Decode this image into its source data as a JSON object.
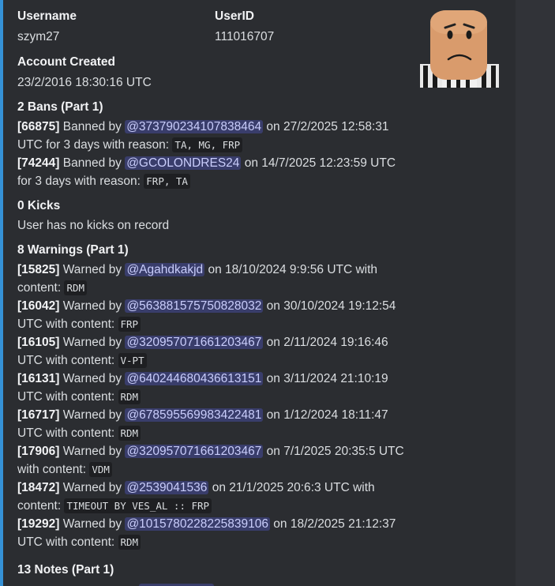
{
  "profile": {
    "username_label": "Username",
    "username_value": "szym27",
    "userid_label": "UserID",
    "userid_value": "111016707",
    "created_label": "Account Created",
    "created_value": "23/2/2016 18:30:16 UTC"
  },
  "bans": {
    "title": "2 Bans (Part 1)",
    "entries": [
      {
        "id": "[66875]",
        "verb": "Banned by",
        "mention": "@373790234107838464",
        "rest": "on 27/2/2025 12:58:31 UTC for 3 days with reason:",
        "code": "TA, MG, FRP"
      },
      {
        "id": "[74244]",
        "verb": "Banned by",
        "mention": "@GCOLONDRES24",
        "rest": "on 14/7/2025 12:23:59 UTC for 3 days with reason:",
        "code": "FRP, TA"
      }
    ]
  },
  "kicks": {
    "title": "0 Kicks",
    "text": "User has no kicks on record"
  },
  "warnings": {
    "title": "8 Warnings (Part 1)",
    "entries": [
      {
        "id": "[15825]",
        "verb": "Warned by",
        "mention": "@Agahdkakjd",
        "rest": "on 18/10/2024 9:9:56 UTC with content:",
        "code": "RDM"
      },
      {
        "id": "[16042]",
        "verb": "Warned by",
        "mention": "@563881575750828032",
        "rest": "on 30/10/2024 19:12:54 UTC with content:",
        "code": "FRP"
      },
      {
        "id": "[16105]",
        "verb": "Warned by",
        "mention": "@320957071661203467",
        "rest": "on 2/11/2024 19:16:46 UTC with content:",
        "code": "V-PT"
      },
      {
        "id": "[16131]",
        "verb": "Warned by",
        "mention": "@640244680436613151",
        "rest": "on 3/11/2024 21:10:19 UTC with content:",
        "code": "RDM"
      },
      {
        "id": "[16717]",
        "verb": "Warned by",
        "mention": "@678595569983422481",
        "rest": "on 1/12/2024 18:11:47 UTC with content:",
        "code": "RDM"
      },
      {
        "id": "[17906]",
        "verb": "Warned by",
        "mention": "@320957071661203467",
        "rest": "on 7/1/2025 20:35:5 UTC with content:",
        "code": "VDM"
      },
      {
        "id": "[18472]",
        "verb": "Warned by",
        "mention": "@2539041536",
        "rest": "on 21/1/2025 20:6:3 UTC with content:",
        "code": "TIMEOUT BY VES_AL :: FRP"
      },
      {
        "id": "[19292]",
        "verb": "Warned by",
        "mention": "@1015780228225839106",
        "rest": "on 18/2/2025 21:12:37 UTC with content:",
        "code": "RDM"
      }
    ]
  },
  "notes": {
    "title": "13 Notes (Part 1)"
  },
  "thumbnail": {
    "icon": "roblox-avatar-icon"
  },
  "colors": {
    "accent": "#3591d6",
    "embed_bg": "#2b2d31",
    "page_bg": "#313338",
    "mention_text": "#c9cdfb"
  }
}
